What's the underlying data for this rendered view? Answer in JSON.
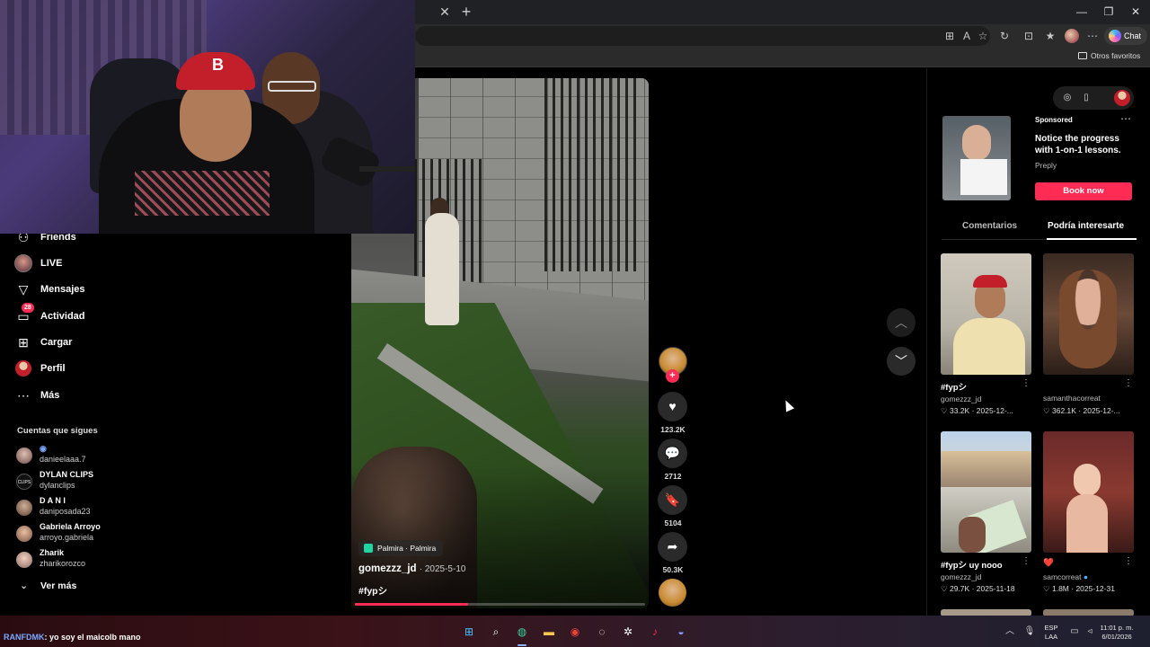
{
  "sidebar": {
    "items": [
      {
        "label": "Friends",
        "icon": "friends-icon"
      },
      {
        "label": "LIVE",
        "icon": "live-icon"
      },
      {
        "label": "Mensajes",
        "icon": "messages-icon"
      },
      {
        "label": "Actividad",
        "icon": "activity-icon",
        "badge": "28"
      },
      {
        "label": "Cargar",
        "icon": "upload-icon"
      },
      {
        "label": "Perfil",
        "icon": "profile-icon"
      },
      {
        "label": "Más",
        "icon": "more-icon"
      }
    ],
    "following_title": "Cuentas que sigues",
    "following": [
      {
        "name": "",
        "user": "danieelaaa.7"
      },
      {
        "name": "DYLAN CLIPS",
        "user": "dylanclips"
      },
      {
        "name": "D A N I",
        "user": "daniposada23"
      },
      {
        "name": "Gabriela Arroyo",
        "user": "arroyo.gabriela"
      },
      {
        "name": "Zharik",
        "user": "zharikorozco"
      }
    ],
    "see_more": "Ver más"
  },
  "browser": {
    "favorites": "Otros favoritos",
    "chat": "Chat"
  },
  "video": {
    "location": "Palmira · Palmira",
    "username": "gomezzz_jd",
    "date": "2025-5-10",
    "caption": "#fypシ",
    "progress": 0.39
  },
  "actions": {
    "likes": "123.2K",
    "comments": "2712",
    "saves": "5104",
    "shares": "50.3K"
  },
  "ad": {
    "sponsored": "Sponsored",
    "title": "Notice the progress with 1-on-1 lessons.",
    "brand": "Preply",
    "cta": "Book now"
  },
  "tabs": [
    "Comentarios",
    "Podría interesarte"
  ],
  "cards": [
    {
      "title": "#fypシ",
      "user": "gomezzz_jd",
      "likes": "33.2K",
      "date": "2025-12-..."
    },
    {
      "title": "",
      "user": "samanthacorreat",
      "likes": "362.1K",
      "date": "2025-12-..."
    },
    {
      "title": "#fypシ uy nooo",
      "user": "gomezzz_jd",
      "likes": "29.7K",
      "date": "2025-11-18"
    },
    {
      "title": "❤️",
      "user": "samcorreat",
      "likes": "1.8M",
      "date": "2025-12-31"
    }
  ],
  "taskbar": {
    "ticker_name": "RANFDMK",
    "ticker_text": ": yo soy el maicolb mano",
    "lang": "ESP",
    "lang2": "LAA",
    "time": "11:01 p. m.",
    "date": "6/01/2026"
  }
}
